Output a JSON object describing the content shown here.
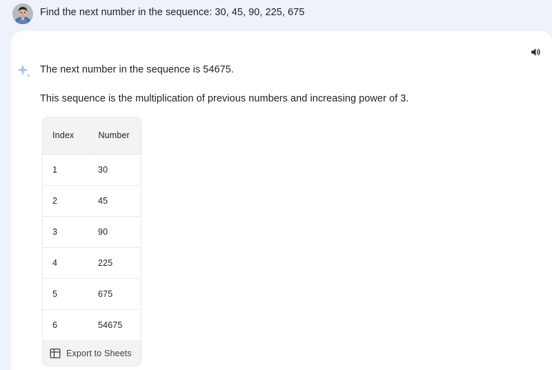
{
  "prompt": {
    "text": "Find the next number in the sequence: 30, 45, 90, 225, 675",
    "avatar_name": "user-avatar-photo"
  },
  "response": {
    "sparkle_icon": "sparkle-icon",
    "speaker_icon": "speaker-icon",
    "answer": "The next number in the sequence is 54675.",
    "explanation": "This sequence is the multiplication of previous numbers and increasing power of 3."
  },
  "table": {
    "columns": [
      "Index",
      "Number"
    ],
    "rows": [
      {
        "index": "1",
        "number": "30"
      },
      {
        "index": "2",
        "number": "45"
      },
      {
        "index": "3",
        "number": "90"
      },
      {
        "index": "4",
        "number": "225"
      },
      {
        "index": "5",
        "number": "675"
      },
      {
        "index": "6",
        "number": "54675"
      }
    ],
    "export_label": "Export to Sheets",
    "export_icon": "table-grid-icon"
  },
  "colors": {
    "page_background": "#eef2fb",
    "card_background": "#ffffff",
    "table_header_background": "#f1f3f4",
    "text_primary": "#1f1f22",
    "sparkle": "#a8c0f0"
  }
}
